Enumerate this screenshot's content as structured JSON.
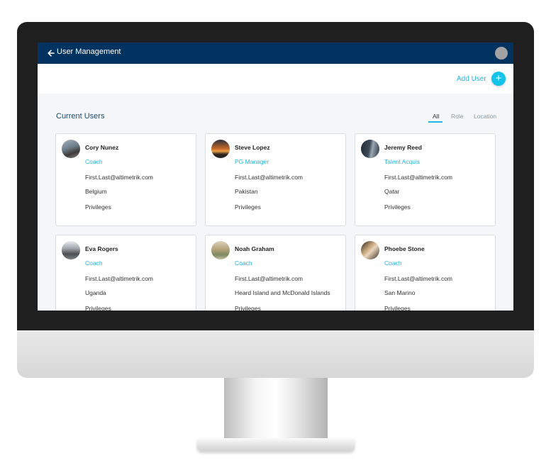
{
  "header": {
    "title": "User Management"
  },
  "actions": {
    "add_user_label": "Add User",
    "add_icon": "+"
  },
  "section": {
    "title": "Current Users"
  },
  "filters": {
    "tabs": [
      "All",
      "Role",
      "Location"
    ],
    "active": "All"
  },
  "users": [
    {
      "name": "Cory Nunez",
      "role": "Coach",
      "email": "First.Last@altimetrik.com",
      "location": "Belgium",
      "privileges": "Privileges"
    },
    {
      "name": "Steve Lopez",
      "role": "PG Manager",
      "email": "First.Last@altimetrik.com",
      "location": "Pakistan",
      "privileges": "Privileges"
    },
    {
      "name": "Jeremy Reed",
      "role": "Talent Acquis",
      "email": "First.Last@altimetrik.com",
      "location": "Qatar",
      "privileges": "Privileges"
    },
    {
      "name": "Eva Rogers",
      "role": "Coach",
      "email": "First.Last@altimetrik.com",
      "location": "Uganda",
      "privileges": "Privileges"
    },
    {
      "name": "Noah Graham",
      "role": "Coach",
      "email": "First.Last@altimetrik.com",
      "location": "Heard Island and McDonald Islands",
      "privileges": "Privileges"
    },
    {
      "name": "Phoebe Stone",
      "role": "Coach",
      "email": "First.Last@altimetrik.com",
      "location": "San Marino",
      "privileges": "Privileges"
    }
  ],
  "colors": {
    "header_bg": "#00335f",
    "accent": "#1fb6e8",
    "page_bg": "#f4f6f8"
  },
  "icons": {
    "back": "arrow-left-icon",
    "add": "plus-icon",
    "profile": "avatar-icon"
  }
}
